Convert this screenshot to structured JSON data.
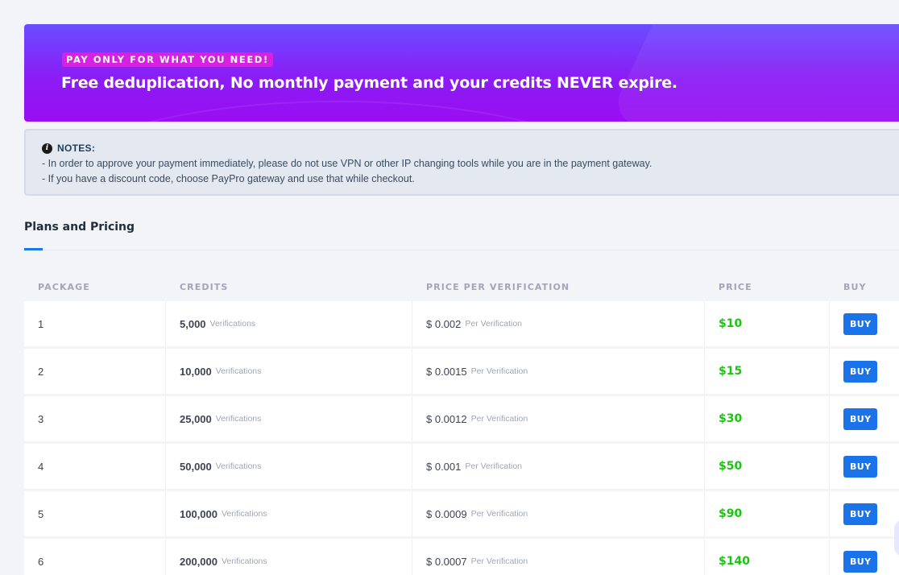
{
  "banner": {
    "badge": "PAY ONLY FOR WHAT YOU NEED!",
    "headline": "Free deduplication, No monthly payment and your credits NEVER expire."
  },
  "notes": {
    "icon": "info-icon",
    "title": "NOTES:",
    "lines": [
      "- In order to approve your payment immediately, please do not use VPN or other IP changing tools while you are in the payment gateway.",
      "- If you have a discount code, choose PayPro gateway and use that while checkout."
    ]
  },
  "tabs": {
    "active": "Plans and Pricing"
  },
  "table": {
    "headers": [
      "PACKAGE",
      "CREDITS",
      "PRICE PER VERIFICATION",
      "PRICE",
      "BUY"
    ],
    "unit_credits": "Verifications",
    "unit_ppv": "Per Verification",
    "buy_label": "BUY",
    "rows": [
      {
        "package": "1",
        "credits": "5,000",
        "ppv": "$ 0.002",
        "price": "$10"
      },
      {
        "package": "2",
        "credits": "10,000",
        "ppv": "$ 0.0015",
        "price": "$15"
      },
      {
        "package": "3",
        "credits": "25,000",
        "ppv": "$ 0.0012",
        "price": "$30"
      },
      {
        "package": "4",
        "credits": "50,000",
        "ppv": "$ 0.001",
        "price": "$50"
      },
      {
        "package": "5",
        "credits": "100,000",
        "ppv": "$ 0.0009",
        "price": "$90"
      },
      {
        "package": "6",
        "credits": "200,000",
        "ppv": "$ 0.0007",
        "price": "$140"
      }
    ]
  },
  "colors": {
    "banner_start": "#6a4dff",
    "banner_end": "#9a0df2",
    "badge": "#d521e0",
    "price": "#1bc50f",
    "button": "#1a73e8",
    "tab_accent": "#1878e8"
  }
}
